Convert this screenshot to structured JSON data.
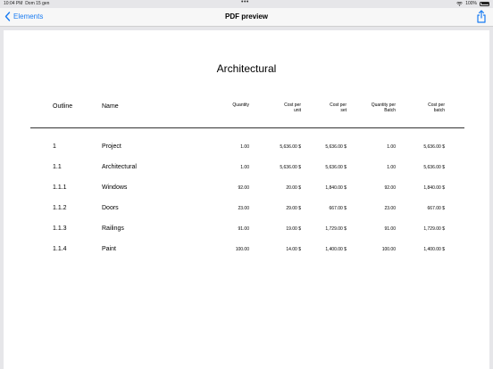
{
  "status": {
    "time": "10:04 PM",
    "date": "Dom 15 gen",
    "dots": "•••",
    "battery": "100%"
  },
  "nav": {
    "back_label": "Elements",
    "title": "PDF preview"
  },
  "document": {
    "title": "Architectural",
    "headers": {
      "outline": "Outline",
      "name": "Name",
      "quantity": "Quantity",
      "cost_unit_1": "Cost per",
      "cost_unit_2": "unit",
      "cost_set_1": "Cost per",
      "cost_set_2": "set",
      "qty_batch_1": "Quantity per",
      "qty_batch_2": "Batch",
      "cost_batch_1": "Cost per",
      "cost_batch_2": "batch"
    },
    "rows": [
      {
        "outline": "1",
        "name": "Project",
        "quantity": "1.00",
        "cost_unit": "5,636.00 $",
        "cost_set": "5,636.00 $",
        "qty_batch": "1.00",
        "cost_batch": "5,636.00 $"
      },
      {
        "outline": "1.1",
        "name": "Architectural",
        "quantity": "1.00",
        "cost_unit": "5,636.00 $",
        "cost_set": "5,636.00 $",
        "qty_batch": "1.00",
        "cost_batch": "5,636.00 $"
      },
      {
        "outline": "1.1.1",
        "name": "Windows",
        "quantity": "92.00",
        "cost_unit": "20.00 $",
        "cost_set": "1,840.00 $",
        "qty_batch": "92.00",
        "cost_batch": "1,840.00 $"
      },
      {
        "outline": "1.1.2",
        "name": "Doors",
        "quantity": "23.00",
        "cost_unit": "29.00 $",
        "cost_set": "667.00 $",
        "qty_batch": "23.00",
        "cost_batch": "667.00 $"
      },
      {
        "outline": "1.1.3",
        "name": "Railings",
        "quantity": "91.00",
        "cost_unit": "19.00 $",
        "cost_set": "1,729.00 $",
        "qty_batch": "91.00",
        "cost_batch": "1,729.00 $"
      },
      {
        "outline": "1.1.4",
        "name": "Paint",
        "quantity": "100.00",
        "cost_unit": "14.00 $",
        "cost_set": "1,400.00 $",
        "qty_batch": "100.00",
        "cost_batch": "1,400.00 $"
      }
    ]
  },
  "colors": {
    "accent": "#1a7cf2",
    "background": "#e6e6e9",
    "page": "#ffffff"
  }
}
